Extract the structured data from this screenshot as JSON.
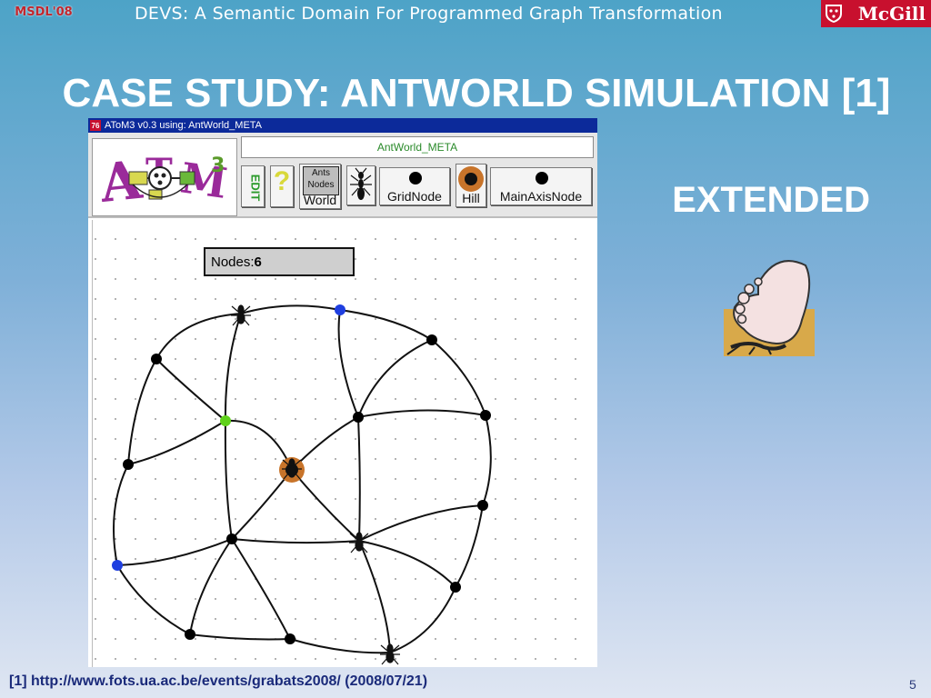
{
  "header": {
    "conference": "MSDL'08",
    "title": "DEVS: A Semantic Domain For Programmed Graph Transformation",
    "university": "McGill"
  },
  "slide": {
    "title": "CASE STUDY: ANTWORLD SIMULATION [1]",
    "extended_label": "EXTENDED",
    "footnote": "[1] http://www.fots.ua.ac.be/events/grabats2008/ (2008/07/21)",
    "page_number": "5"
  },
  "app_window": {
    "title": "AToM3 v0.3 using: AntWorld_META",
    "icon_label": "76",
    "metamodel_field": "AntWorld_META",
    "toolbar_buttons": {
      "edit": "EDIT",
      "help": "?",
      "world_top": "Ants",
      "world_mid": "Nodes",
      "world": "World",
      "gridnode": "GridNode",
      "hill": "Hill",
      "mainaxisnode": "MainAxisNode"
    },
    "nodes_counter": {
      "label": "Nodes:",
      "value": "6"
    }
  },
  "colors": {
    "node_default": "#000000",
    "node_main_axis": "#1f3fe0",
    "node_selected": "#5fd11a",
    "hill": "#c8742a",
    "mcgill_red": "#c8102e"
  }
}
